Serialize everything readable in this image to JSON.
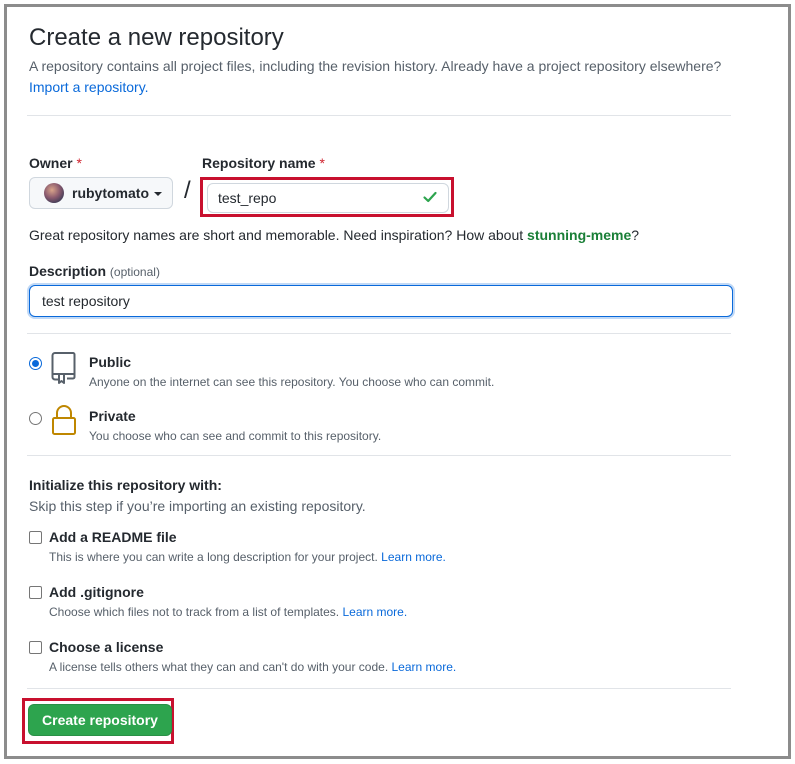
{
  "page": {
    "title": "Create a new repository",
    "subtitle": "A repository contains all project files, including the revision history. Already have a project repository elsewhere?",
    "import_link": "Import a repository."
  },
  "owner": {
    "label": "Owner",
    "required_mark": "*",
    "value": "rubytomato"
  },
  "separator": "/",
  "repo_name": {
    "label": "Repository name",
    "required_mark": "*",
    "value": "test_repo",
    "valid_icon": "check-icon"
  },
  "name_hint": {
    "text": "Great repository names are short and memorable. Need inspiration? How about ",
    "suggestion": "stunning-meme",
    "end": "?"
  },
  "description": {
    "label": "Description",
    "optional": "(optional)",
    "value": "test repository"
  },
  "visibility": {
    "public": {
      "title": "Public",
      "desc": "Anyone on the internet can see this repository. You choose who can commit.",
      "icon": "repo-book-icon",
      "selected": true
    },
    "private": {
      "title": "Private",
      "desc": "You choose who can see and commit to this repository.",
      "icon": "lock-icon",
      "selected": false
    }
  },
  "init": {
    "title": "Initialize this repository with:",
    "subtitle": "Skip this step if you’re importing an existing repository.",
    "options": [
      {
        "label": "Add a README file",
        "desc": "This is where you can write a long description for your project.",
        "learn": "Learn more."
      },
      {
        "label": "Add .gitignore",
        "desc": "Choose which files not to track from a list of templates.",
        "learn": "Learn more."
      },
      {
        "label": "Choose a license",
        "desc": "A license tells others what they can and can't do with your code.",
        "learn": "Learn more."
      }
    ]
  },
  "create_button": "Create repository",
  "colors": {
    "primary_green": "#2da44e",
    "link_blue": "#0969da",
    "highlight_red": "#c8102e",
    "check_green": "#2da44e",
    "lock_gold": "#bf8700"
  }
}
